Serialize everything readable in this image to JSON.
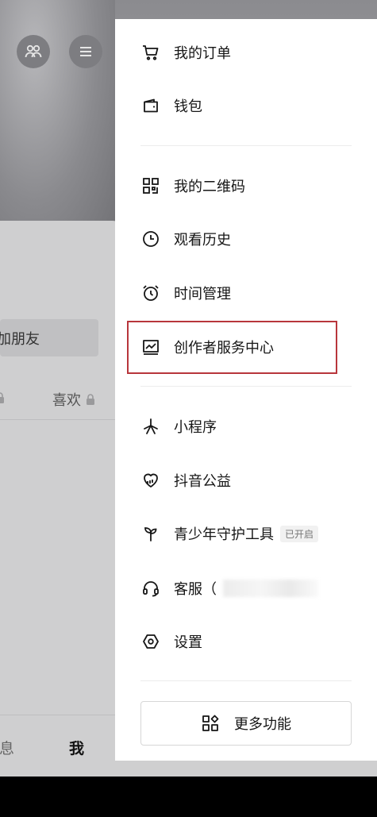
{
  "background": {
    "add_friend": "加朋友",
    "likes_tab": "喜欢",
    "nav_message": "消息",
    "nav_me": "我"
  },
  "drawer": {
    "items": [
      {
        "label": "我的订单",
        "icon": "cart-icon"
      },
      {
        "label": "钱包",
        "icon": "wallet-icon"
      },
      {
        "label": "我的二维码",
        "icon": "qr-code-icon"
      },
      {
        "label": "观看历史",
        "icon": "clock-icon"
      },
      {
        "label": "时间管理",
        "icon": "alarm-clock-icon"
      },
      {
        "label": "创作者服务中心",
        "icon": "chart-icon"
      },
      {
        "label": "小程序",
        "icon": "mini-program-icon"
      },
      {
        "label": "抖音公益",
        "icon": "charity-heart-icon"
      },
      {
        "label": "青少年守护工具",
        "icon": "sprout-icon",
        "badge": "已开启"
      },
      {
        "label": "客服（",
        "icon": "headset-icon"
      },
      {
        "label": "设置",
        "icon": "settings-hexagon-icon"
      }
    ],
    "more_button": "更多功能"
  },
  "colors": {
    "highlight": "#b8363c",
    "drawer_bg": "#ffffff"
  }
}
